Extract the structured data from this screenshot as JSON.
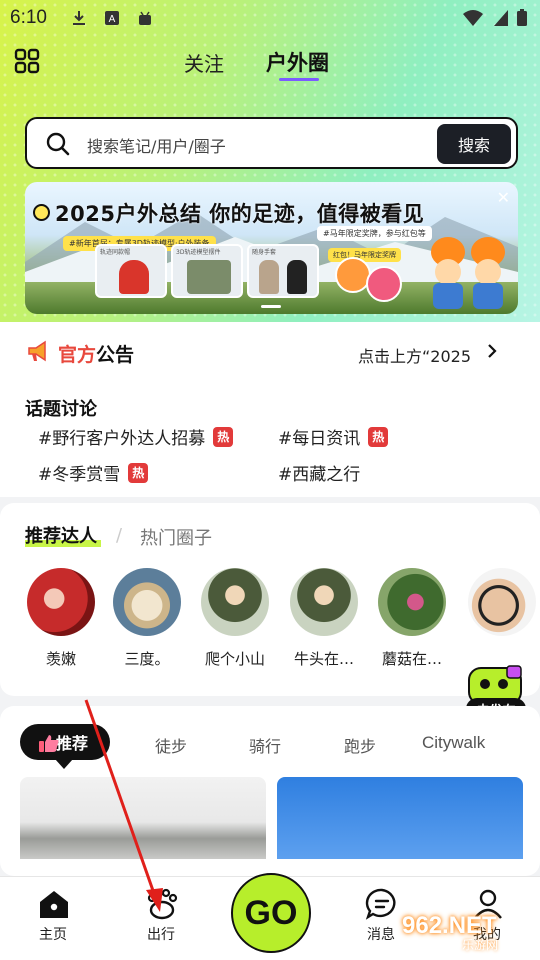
{
  "status_bar": {
    "time": "6:10"
  },
  "header": {
    "tabs": [
      {
        "label": "关注",
        "active": false
      },
      {
        "label": "户外圈",
        "active": true
      }
    ]
  },
  "search": {
    "placeholder": "搜索笔记/用户/圈子",
    "button_label": "搜索"
  },
  "banner": {
    "title": "2025户外总结 你的足迹，值得被看见",
    "tag_left": "#新年首届：专属3D轨迹模型·户外装备",
    "tag_right": "#马年限定奖牌，参与红包等",
    "tag_right_2": "红包！马年限定奖牌",
    "cards": [
      "轨迹同款帽",
      "3D轨迹模型摆件",
      "随身手套"
    ]
  },
  "announcement": {
    "title_red": "官方",
    "title_black": "公告",
    "link_text": "点击上方“2025"
  },
  "topics": {
    "title": "话题讨论",
    "items": [
      {
        "label": "#野行客户外达人招募",
        "hot": true
      },
      {
        "label": "#每日资讯",
        "hot": true
      },
      {
        "label": "#冬季赏雪",
        "hot": true
      },
      {
        "label": "#西藏之行",
        "hot": false
      }
    ],
    "hot_label": "热"
  },
  "people": {
    "tabs": [
      {
        "label": "推荐达人",
        "active": true
      },
      {
        "label": "热门圈子",
        "active": false
      }
    ],
    "separator": "/",
    "users": [
      {
        "name": "羡嫩"
      },
      {
        "name": "三度。"
      },
      {
        "name": "爬个小山"
      },
      {
        "name": "牛头在…"
      },
      {
        "name": "蘑菇在…"
      }
    ]
  },
  "publish": {
    "label": "去发布"
  },
  "feed": {
    "tabs": [
      {
        "label": "推荐",
        "active": true
      },
      {
        "label": "徒步",
        "active": false
      },
      {
        "label": "骑行",
        "active": false
      },
      {
        "label": "跑步",
        "active": false
      },
      {
        "label": "Citywalk",
        "active": false
      }
    ]
  },
  "bottom_nav": {
    "items": [
      {
        "label": "主页"
      },
      {
        "label": "出行"
      },
      {
        "label": "GO"
      },
      {
        "label": "消息"
      },
      {
        "label": "我的"
      }
    ]
  },
  "watermark": {
    "main": "962.NET",
    "sub": "乐游网"
  },
  "colors": {
    "accent_green": "#b7ee2b",
    "accent_purple": "#7b5cff",
    "hot_red": "#e23a3a",
    "notice_red": "#e8483d"
  }
}
